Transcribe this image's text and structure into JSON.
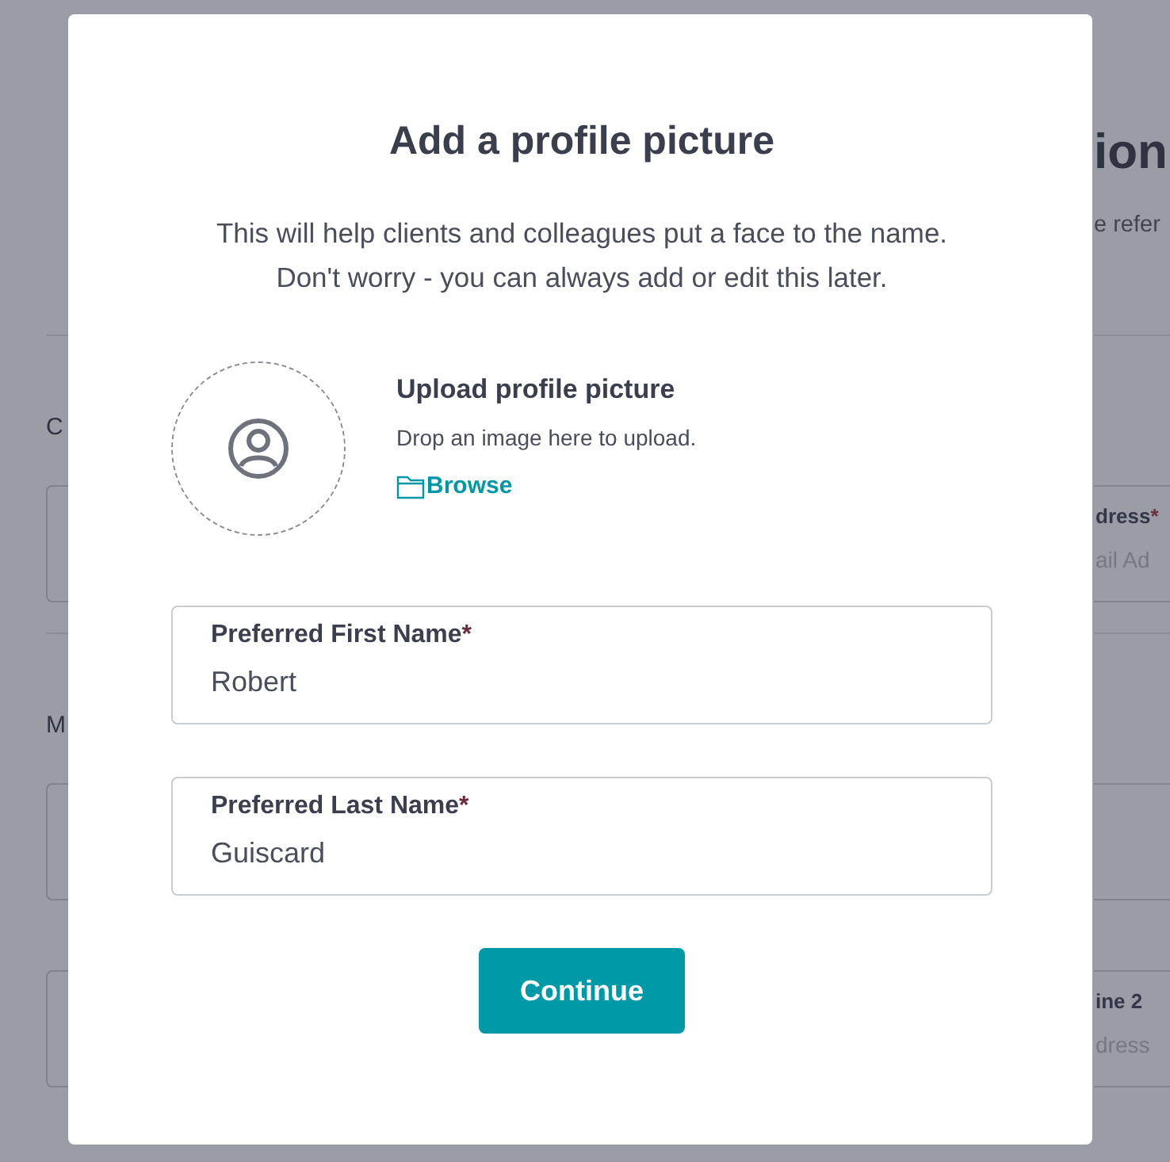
{
  "background_page": {
    "title": "ion",
    "subtitle": "e refer",
    "left_sections": [
      {
        "heading": "C",
        "fields": [
          {
            "kind": "text_field"
          }
        ]
      },
      {
        "heading": "M",
        "fields": [
          {
            "kind": "text_field"
          },
          {
            "kind": "text_field"
          }
        ]
      }
    ],
    "right_sections": [
      {
        "fields": [
          {
            "kind": "text_field",
            "label": "dress",
            "required_mark": "*",
            "placeholder": "ail Ad"
          }
        ]
      },
      {
        "fields": [
          {
            "kind": "text_field"
          },
          {
            "kind": "text_field",
            "label": "ine 2",
            "placeholder": "dress"
          }
        ]
      }
    ]
  },
  "dialog": {
    "title": "Add a profile picture",
    "description_lines": [
      "This will help clients and colleagues put a face to the name.",
      "Don't worry - you can always add or edit this later."
    ],
    "upload": {
      "title": "Upload profile picture",
      "hint": "Drop an image here to upload.",
      "browse_link": "Browse"
    },
    "fields": [
      {
        "label": "Preferred First Name",
        "required_mark": "*",
        "value": "Robert"
      },
      {
        "label": "Preferred Last Name",
        "required_mark": "*",
        "value": "Guiscard"
      }
    ],
    "button": "Continue"
  }
}
